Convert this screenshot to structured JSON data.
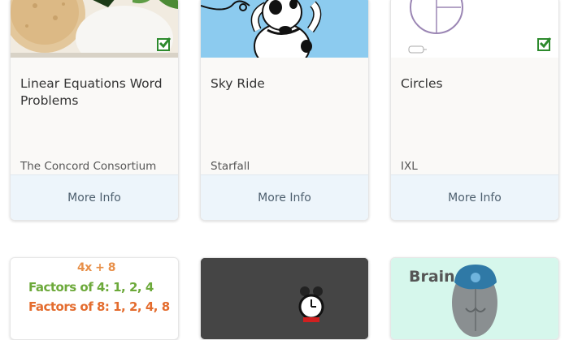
{
  "cards_row1": [
    {
      "title": "Linear Equations Word Problems",
      "provider": "The Concord Consortium",
      "more": "More Info",
      "completed": true
    },
    {
      "title": "Sky Ride",
      "provider": "Starfall",
      "more": "More Info",
      "completed": false
    },
    {
      "title": "Circles",
      "provider": "IXL",
      "more": "More Info",
      "completed": true
    }
  ],
  "cards_row2": [
    {
      "thumb_lines": [
        "4x + 8",
        "Factors of 4: 1, 2, 4",
        "Factors of 8: 1, 2, 4, 8"
      ]
    },
    {},
    {
      "thumb_text": "Brain"
    }
  ],
  "colors": {
    "more_info_bg": "#edf5fb",
    "check_green": "#2d8a2d",
    "sky_blue": "#8ccbef",
    "mint": "#d6f7ec"
  }
}
